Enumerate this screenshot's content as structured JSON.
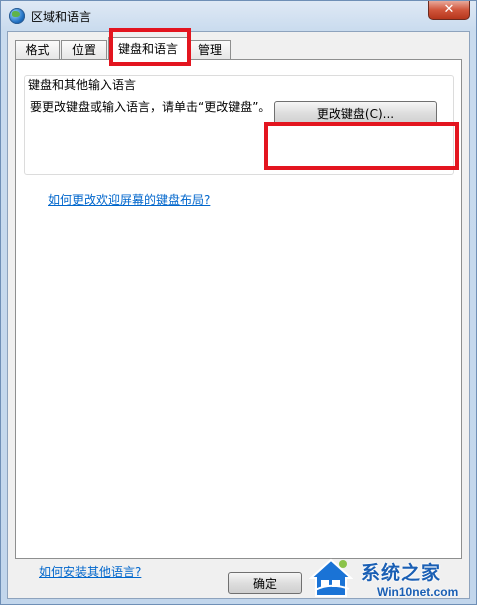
{
  "window": {
    "title": "区域和语言",
    "close_symbol": "✕"
  },
  "tabs": [
    {
      "label": "格式"
    },
    {
      "label": "位置"
    },
    {
      "label": "键盘和语言"
    },
    {
      "label": "管理"
    }
  ],
  "keyboard_group": {
    "title": "键盘和其他输入语言",
    "description": "要更改键盘或输入语言，请单击“更改键盘”。",
    "change_button": "更改键盘(C)..."
  },
  "links": {
    "welcome_layout": "如何更改欢迎屏幕的键盘布局?",
    "install_languages": "如何安装其他语言?"
  },
  "footer": {
    "ok_button": "确定"
  },
  "watermark": {
    "brand": "系统之家",
    "site": "Win10net.com"
  },
  "colors": {
    "highlight": "#e3151f",
    "link": "#0066cc"
  },
  "icons": {
    "title": "globe-icon",
    "close": "close-icon"
  }
}
